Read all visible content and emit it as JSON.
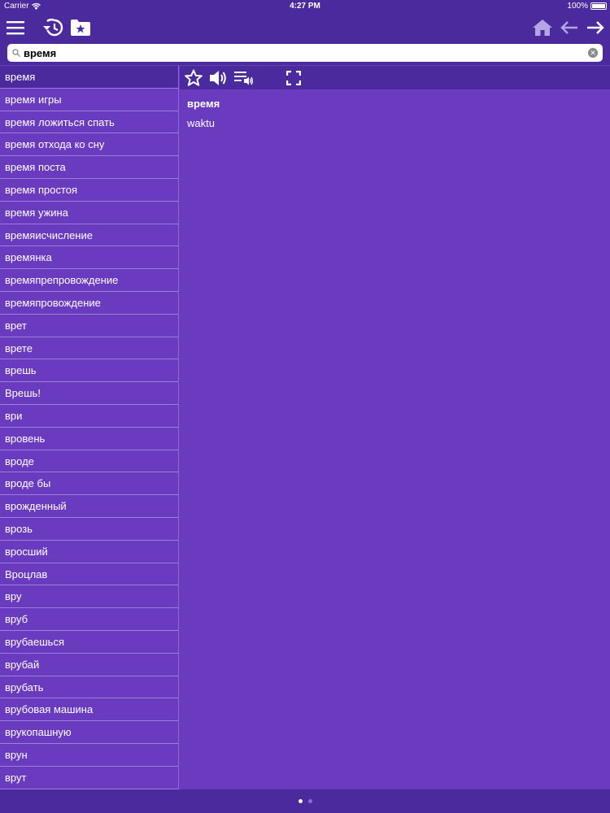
{
  "status": {
    "carrier": "Carrier",
    "time": "4:27 PM",
    "battery": "100%"
  },
  "toolbar": {
    "menu_icon": "hamburger-menu-icon",
    "history_icon": "history-icon",
    "favorites_icon": "favorites-folder-icon",
    "home_icon": "home-icon",
    "back_icon": "arrow-left-icon",
    "forward_icon": "arrow-right-icon"
  },
  "search": {
    "value": "время",
    "placeholder": ""
  },
  "word_list": [
    "время",
    "время игры",
    "время ложиться спать",
    "время отхода ко сну",
    "время поста",
    "время простоя",
    "время ужина",
    "времяисчисление",
    "времянка",
    "времяпрепровождение",
    "времяпровождение",
    "врет",
    "врете",
    "врешь",
    "Врешь!",
    "ври",
    "вровень",
    "вроде",
    "вроде бы",
    "врожденный",
    "врозь",
    "вросший",
    "Вроцлав",
    "вру",
    "вруб",
    "врубаешься",
    "врубай",
    "врубать",
    "врубовая машина",
    "врукопашную",
    "врун",
    "врут"
  ],
  "selected_index": 0,
  "entry": {
    "headword": "время",
    "translation": "waktu"
  },
  "pager": {
    "pages": 2,
    "current": 0
  },
  "colors": {
    "bar": "#4a2a9c",
    "background": "#6a3bbe",
    "divider": "#9d80dc",
    "text": "#ffffff"
  }
}
